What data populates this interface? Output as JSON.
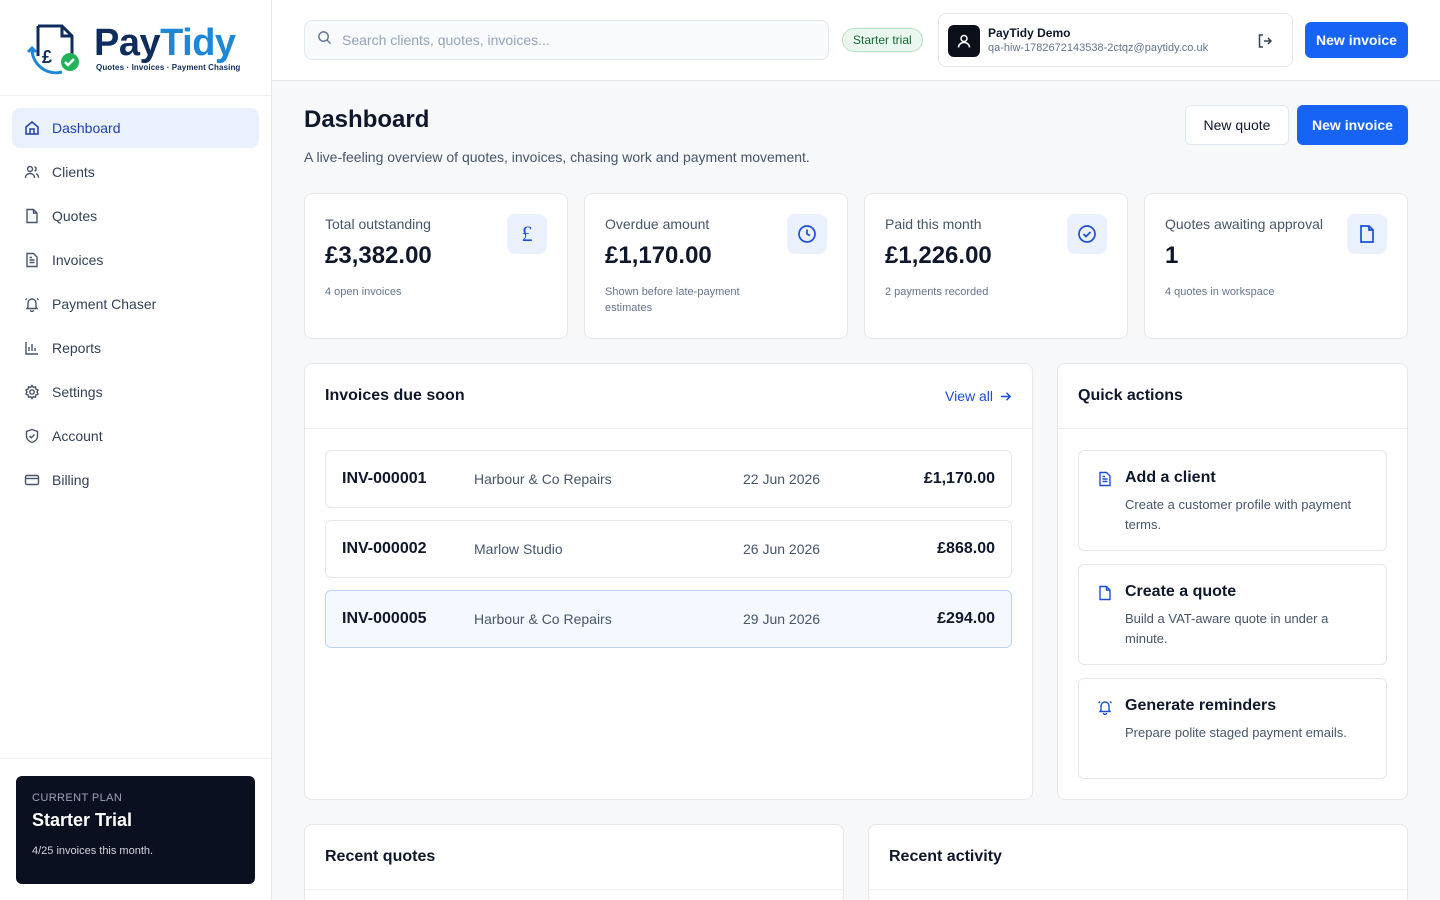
{
  "brand": {
    "name_part1": "Pay",
    "name_part2": "Tidy",
    "tagline": "Quotes · Invoices · Payment Chasing"
  },
  "sidebar": {
    "items": [
      {
        "label": "Dashboard",
        "icon": "home-icon",
        "active": true
      },
      {
        "label": "Clients",
        "icon": "users-icon"
      },
      {
        "label": "Quotes",
        "icon": "file-icon"
      },
      {
        "label": "Invoices",
        "icon": "invoice-icon"
      },
      {
        "label": "Payment Chaser",
        "icon": "bell-icon"
      },
      {
        "label": "Reports",
        "icon": "bar-chart-icon"
      },
      {
        "label": "Settings",
        "icon": "gear-icon"
      },
      {
        "label": "Account",
        "icon": "shield-icon"
      },
      {
        "label": "Billing",
        "icon": "card-icon"
      }
    ],
    "plan": {
      "label": "CURRENT PLAN",
      "name": "Starter Trial",
      "usage": "4/25 invoices this month."
    }
  },
  "topbar": {
    "search_placeholder": "Search clients, quotes, invoices...",
    "trial_badge": "Starter trial",
    "user_name": "PayTidy Demo",
    "user_email": "qa-hiw-1782672143538-2ctqz@paytidy.co.uk",
    "new_invoice_label": "New invoice"
  },
  "page": {
    "title": "Dashboard",
    "subtitle": "A live-feeling overview of quotes, invoices, chasing work and payment movement.",
    "new_quote_label": "New quote",
    "new_invoice_label": "New invoice"
  },
  "stats": [
    {
      "label": "Total outstanding",
      "value": "£3,382.00",
      "note": "4 open invoices",
      "icon": "pound-icon"
    },
    {
      "label": "Overdue amount",
      "value": "£1,170.00",
      "note": "Shown before late-payment estimates",
      "icon": "clock-icon"
    },
    {
      "label": "Paid this month",
      "value": "£1,226.00",
      "note": "2 payments recorded",
      "icon": "check-circle-icon"
    },
    {
      "label": "Quotes awaiting approval",
      "value": "1",
      "note": "4 quotes in workspace",
      "icon": "document-icon"
    }
  ],
  "due_soon": {
    "title": "Invoices due soon",
    "view_all": "View all",
    "rows": [
      {
        "number": "INV-000001",
        "client": "Harbour & Co Repairs",
        "date": "22 Jun 2026",
        "amount": "£1,170.00"
      },
      {
        "number": "INV-000002",
        "client": "Marlow Studio",
        "date": "26 Jun 2026",
        "amount": "£868.00"
      },
      {
        "number": "INV-000005",
        "client": "Harbour & Co Repairs",
        "date": "29 Jun 2026",
        "amount": "£294.00"
      }
    ]
  },
  "quick_actions": {
    "title": "Quick actions",
    "items": [
      {
        "title": "Add a client",
        "desc": "Create a customer profile with payment terms.",
        "icon": "invoice-icon"
      },
      {
        "title": "Create a quote",
        "desc": "Build a VAT-aware quote in under a minute.",
        "icon": "file-icon"
      },
      {
        "title": "Generate reminders",
        "desc": "Prepare polite staged payment emails.",
        "icon": "bell-icon"
      }
    ]
  },
  "recent_quotes": {
    "title": "Recent quotes"
  },
  "recent_activity": {
    "title": "Recent activity"
  }
}
